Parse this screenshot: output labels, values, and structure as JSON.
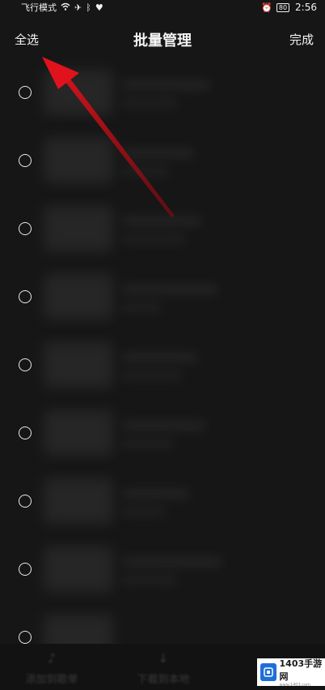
{
  "status_bar": {
    "mode_text": "飞行模式",
    "battery": "80",
    "time": "2:56"
  },
  "header": {
    "select_all": "全选",
    "title": "批量管理",
    "done": "完成"
  },
  "list": {
    "items": [
      {
        "checked": false
      },
      {
        "checked": false
      },
      {
        "checked": false
      },
      {
        "checked": false
      },
      {
        "checked": false
      },
      {
        "checked": false
      },
      {
        "checked": false
      },
      {
        "checked": false
      },
      {
        "checked": false
      }
    ]
  },
  "bottom_bar": {
    "left_label": "添加到歌单",
    "middle_label": "下载到本地"
  },
  "watermark": {
    "title": "1403手游网",
    "subtitle": "www.1403.com"
  },
  "colors": {
    "background": "#161616",
    "arrow": "#e0121b",
    "text": "#f4f4f4"
  }
}
